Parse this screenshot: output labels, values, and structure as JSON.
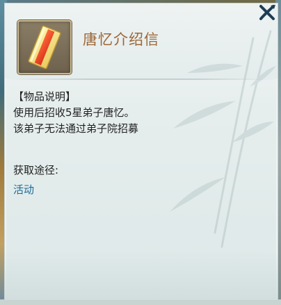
{
  "item": {
    "name": "唐忆介绍信",
    "icon": "scroll-letter-icon"
  },
  "description": {
    "heading": "【物品说明】",
    "lines": [
      "使用后招收5星弟子唐忆。",
      "该弟子无法通过弟子院招募"
    ]
  },
  "source": {
    "heading": "获取途径:",
    "link": "活动"
  },
  "colors": {
    "title": "#9c6636",
    "link": "#1f6a96",
    "text": "#222222"
  }
}
